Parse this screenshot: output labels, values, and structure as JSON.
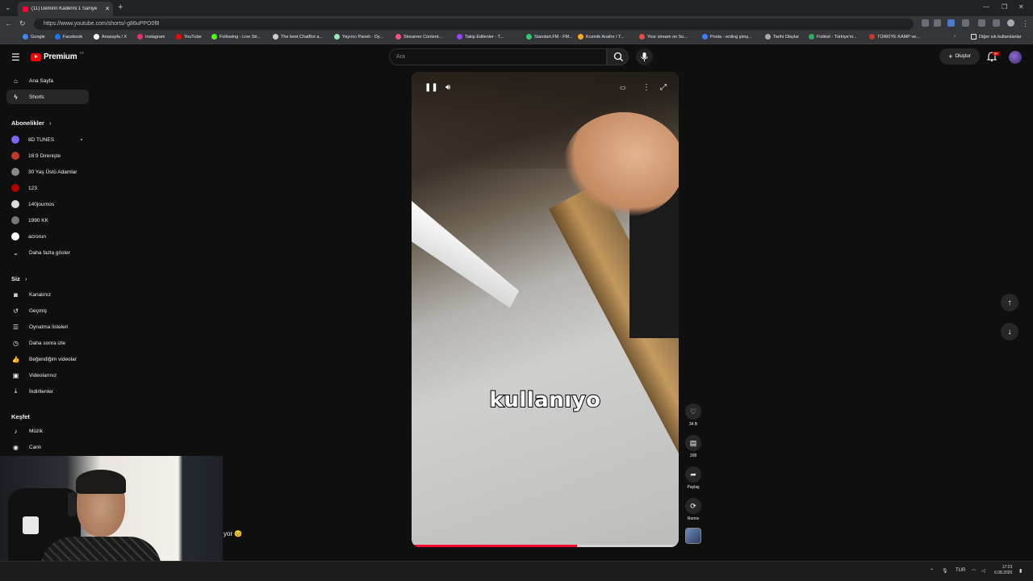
{
  "browser": {
    "tab_title": "(11) Demirin Kaderini 1 Saniye",
    "url": "https://www.youtube.com/shorts/-g86uPPO0f8",
    "bookmarks": [
      {
        "label": "Google",
        "color": "#4285f4"
      },
      {
        "label": "Facebook",
        "color": "#1877f2"
      },
      {
        "label": "Anasayfa / X",
        "color": "#ffffff"
      },
      {
        "label": "Instagram",
        "color": "#e1306c"
      },
      {
        "label": "YouTube",
        "color": "#ff0000"
      },
      {
        "label": "Following - Live Str...",
        "color": "#53fc18"
      },
      {
        "label": "The best ChatBot a...",
        "color": "#cccccc"
      },
      {
        "label": "Yayıncı Paneli - Oy...",
        "color": "#9ae6b4"
      },
      {
        "label": "Streamer Content...",
        "color": "#ff4f81"
      },
      {
        "label": "Takip Edilenler - T...",
        "color": "#9146ff"
      },
      {
        "label": "Standart.FM - FM...",
        "color": "#2ecc71"
      },
      {
        "label": "Kozmik Anafor / T...",
        "color": "#f5a623"
      },
      {
        "label": "Your stream on So...",
        "color": "#e74c3c"
      },
      {
        "label": "Posta - erding şimş...",
        "color": "#3b82f6"
      },
      {
        "label": "Tarihi Olaylar",
        "color": "#aaaaaa"
      },
      {
        "label": "Fizikist - Türkiye'ni...",
        "color": "#27ae60"
      },
      {
        "label": "TÜRKİYE KAMP ve...",
        "color": "#c0392b"
      }
    ],
    "other_bookmarks": "Diğer sık kullanılanlar"
  },
  "header": {
    "logo_text": "Premium",
    "logo_region": "TR",
    "search_placeholder": "Ara",
    "create_label": "Oluştur",
    "notif_count": "9+"
  },
  "sidebar": {
    "main": [
      {
        "label": "Ana Sayfa",
        "icon": "home-icon",
        "glyph": "⌂"
      },
      {
        "label": "Shorts",
        "icon": "shorts-icon",
        "glyph": "ϟ"
      }
    ],
    "subs_heading": "Abonelikler",
    "subs": [
      {
        "label": "8D TUNES",
        "color": "#7b68ee"
      },
      {
        "label": "16:9 Direnişte",
        "color": "#c0392b"
      },
      {
        "label": "30 Yaş Üstü Adamlar",
        "color": "#888888"
      },
      {
        "label": "123",
        "color": "#b30000"
      },
      {
        "label": "140journos",
        "color": "#dddddd"
      },
      {
        "label": "1990 KK",
        "color": "#777777"
      },
      {
        "label": "acrorun",
        "color": "#ffffff"
      }
    ],
    "show_more": "Daha fazla göster",
    "you_heading": "Siz",
    "you": [
      {
        "label": "Kanalınız",
        "glyph": "◙"
      },
      {
        "label": "Geçmiş",
        "glyph": "↺"
      },
      {
        "label": "Oynatma listeleri",
        "glyph": "☰"
      },
      {
        "label": "Daha sonra izle",
        "glyph": "◷"
      },
      {
        "label": "Beğendiğim videolar",
        "glyph": "👍"
      },
      {
        "label": "Videolarınız",
        "glyph": "▣"
      },
      {
        "label": "İndirilenler",
        "glyph": "⤓"
      }
    ],
    "explore_heading": "Keşfet",
    "explore": [
      {
        "label": "Müzik",
        "glyph": "♪"
      },
      {
        "label": "Canlı",
        "glyph": "◉"
      }
    ]
  },
  "video": {
    "caption": "kullanıyo",
    "progress": 0.62
  },
  "actions": {
    "like_count": "34 B",
    "comment_count": "208",
    "share_label": "Paylaş",
    "remix_label": "Remix"
  },
  "chat_message": "yor 😊",
  "taskbar": {
    "lang": "TUR",
    "time": "17:23",
    "date": "6.08.2026"
  }
}
